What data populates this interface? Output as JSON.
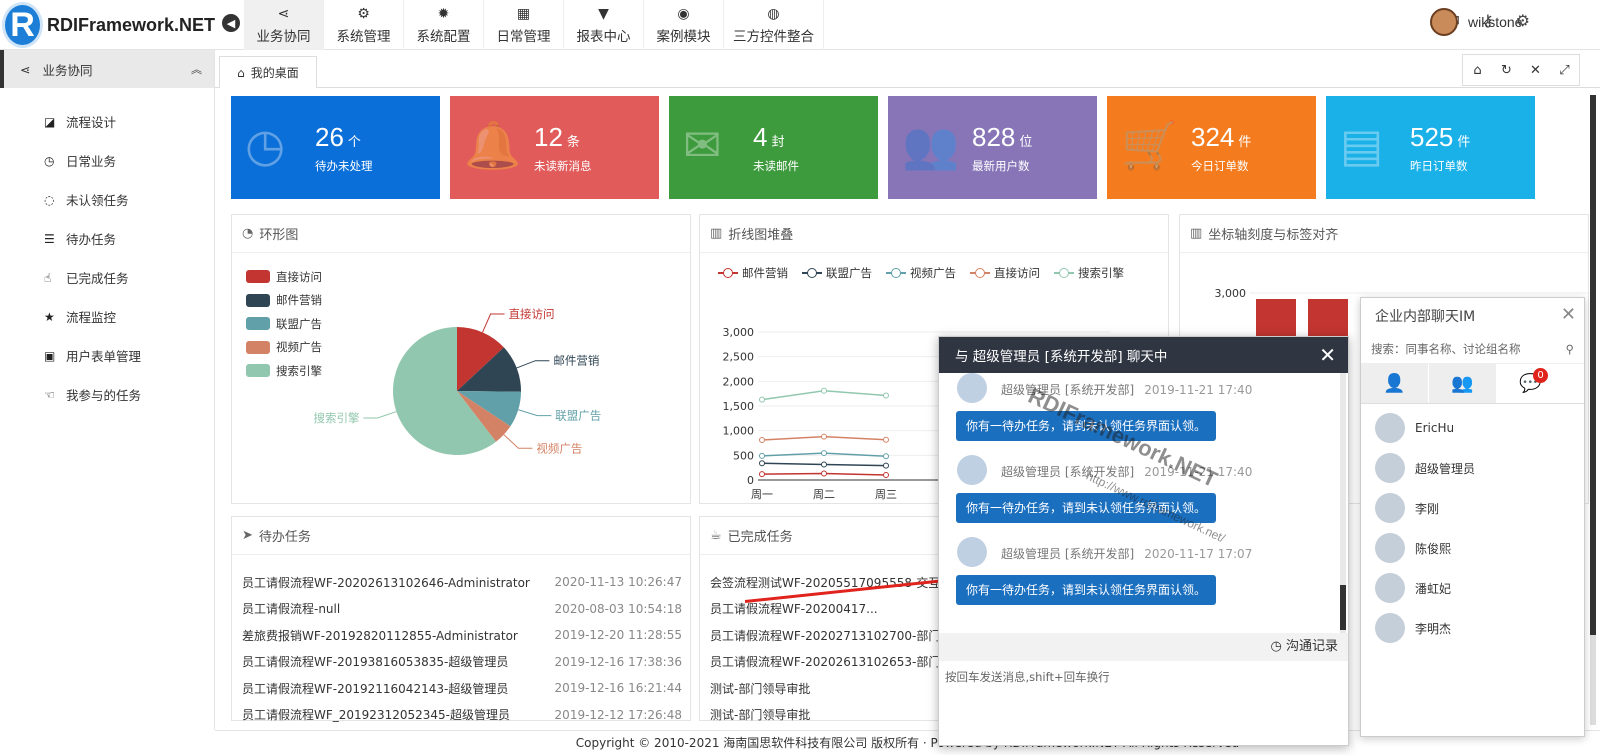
{
  "brand": {
    "logo_letter": "R",
    "name": "RDIFramework.NET"
  },
  "topnav": [
    {
      "label": "业务协同",
      "icon": "share-icon",
      "active": true
    },
    {
      "label": "系统管理",
      "icon": "gears-icon"
    },
    {
      "label": "系统配置",
      "icon": "gear-icon"
    },
    {
      "label": "日常管理",
      "icon": "calendar-icon"
    },
    {
      "label": "报表中心",
      "icon": "filter-icon"
    },
    {
      "label": "案例模块",
      "icon": "eye-icon"
    },
    {
      "label": "三方控件整合",
      "icon": "globe-icon"
    }
  ],
  "user": {
    "name": "wikstone"
  },
  "sidebar": {
    "title": "业务协同",
    "items": [
      {
        "label": "流程设计",
        "icon": "edit-icon"
      },
      {
        "label": "日常业务",
        "icon": "clock-icon"
      },
      {
        "label": "未认领任务",
        "icon": "circle-icon"
      },
      {
        "label": "待办任务",
        "icon": "list-icon"
      },
      {
        "label": "已完成任务",
        "icon": "hand-icon"
      },
      {
        "label": "流程监控",
        "icon": "star-icon"
      },
      {
        "label": "用户表单管理",
        "icon": "form-icon"
      },
      {
        "label": "我参与的任务",
        "icon": "hand-left-icon"
      }
    ]
  },
  "tab": {
    "label": "我的桌面"
  },
  "stats": [
    {
      "num": "26",
      "unit": "个",
      "label": "待办未处理",
      "color": "#0a6fd8",
      "icon": "clock-icon"
    },
    {
      "num": "12",
      "unit": "条",
      "label": "未读新消息",
      "color": "#e25b5b",
      "icon": "bell-icon"
    },
    {
      "num": "4",
      "unit": "封",
      "label": "未读邮件",
      "color": "#3d9a3d",
      "icon": "envelope-icon"
    },
    {
      "num": "828",
      "unit": "位",
      "label": "最新用户数",
      "color": "#8775b8",
      "icon": "users-icon"
    },
    {
      "num": "324",
      "unit": "件",
      "label": "今日订单数",
      "color": "#f47c1f",
      "icon": "cart-icon"
    },
    {
      "num": "525",
      "unit": "件",
      "label": "昨日订单数",
      "color": "#1ab0e8",
      "icon": "doc-icon"
    }
  ],
  "panels": {
    "pie": {
      "title": "环形图"
    },
    "line": {
      "title": "折线图堆叠"
    },
    "bar": {
      "title": "坐标轴刻度与标签对齐"
    },
    "todo": {
      "title": "待办任务"
    },
    "done": {
      "title": "已完成任务"
    }
  },
  "chart_data": [
    {
      "type": "pie",
      "title": "环形图",
      "legend_placement": "top-left",
      "series": [
        {
          "name": "直接访问",
          "value": 335,
          "color": "#c23531"
        },
        {
          "name": "邮件营销",
          "value": 310,
          "color": "#2f4554"
        },
        {
          "name": "联盟广告",
          "value": 234,
          "color": "#61a0a8"
        },
        {
          "name": "视频广告",
          "value": 135,
          "color": "#d48265"
        },
        {
          "name": "搜索引擎",
          "value": 1548,
          "color": "#91c7ae"
        }
      ]
    },
    {
      "type": "line",
      "title": "折线图堆叠",
      "categories": [
        "周一",
        "周二",
        "周三"
      ],
      "ylim": [
        0,
        3000
      ],
      "yticks": [
        "0",
        "500",
        "1,000",
        "1,500",
        "2,000",
        "2,500",
        "3,000"
      ],
      "series": [
        {
          "name": "邮件营销",
          "color": "#c23531",
          "values": [
            120,
            132,
            101
          ]
        },
        {
          "name": "联盟广告",
          "color": "#2f4554",
          "values": [
            340,
            314,
            292
          ]
        },
        {
          "name": "视频广告",
          "color": "#61a0a8",
          "values": [
            490,
            546,
            482
          ]
        },
        {
          "name": "直接访问",
          "color": "#d48265",
          "values": [
            810,
            878,
            816
          ]
        },
        {
          "name": "搜索引擎",
          "color": "#91c7ae",
          "values": [
            1630,
            1810,
            1712
          ]
        }
      ]
    },
    {
      "type": "bar",
      "title": "坐标轴刻度与标签对齐",
      "ylim": [
        0,
        3000
      ],
      "yticks": [
        "3,000"
      ],
      "values": [
        3000,
        3000
      ],
      "color": "#c23531"
    }
  ],
  "todo": [
    {
      "title": "员工请假流程WF-20202613102646-Administrator",
      "date": "2020-11-13 10:26:47"
    },
    {
      "title": "员工请假流程-null",
      "date": "2020-08-03 10:54:18"
    },
    {
      "title": "差旅费报销WF-20192820112855-Administrator",
      "date": "2019-12-20 11:28:55"
    },
    {
      "title": "员工请假流程WF-20193816053835-超级管理员",
      "date": "2019-12-16 17:38:36"
    },
    {
      "title": "员工请假流程WF-20192116042143-超级管理员",
      "date": "2019-12-16 16:21:44"
    },
    {
      "title": "员工请假流程WF_20192312052345-超级管理员",
      "date": "2019-12-12 17:26:48"
    }
  ],
  "done": [
    {
      "title": "会签流程测试WF-20205517095558-交互"
    },
    {
      "title": "员工请假流程WF-20200417..."
    },
    {
      "title": "员工请假流程WF-20202713102700-部门"
    },
    {
      "title": "员工请假流程WF-20202613102653-部门"
    },
    {
      "title": "测试-部门领导审批"
    },
    {
      "title": "测试-部门领导审批"
    }
  ],
  "chat": {
    "title": "与 超级管理员 [系统开发部] 聊天中",
    "messages": [
      {
        "who": "超级管理员 [系统开发部]",
        "time": "2019-11-21 17:40",
        "text": "你有一待办任务，请到未认领任务界面认领。"
      },
      {
        "who": "超级管理员 [系统开发部]",
        "time": "2019-11-21 17:40",
        "text": "你有一待办任务，请到未认领任务界面认领。"
      },
      {
        "who": "超级管理员 [系统开发部]",
        "time": "2020-11-17 17:07",
        "text": "你有一待办任务，请到未认领任务界面认领。"
      }
    ],
    "history": "沟通记录",
    "input_hint": "按回车发送消息,shift+回车换行",
    "watermark": "RDIFramework.NET",
    "watermark_url": "http://www.rdiframework.net/"
  },
  "im": {
    "title": "企业内部聊天IM",
    "search_placeholder": "搜索：同事名称、讨论组名称",
    "badge": "0",
    "contacts": [
      "EricHu",
      "超级管理员",
      "李刚",
      "陈俊熙",
      "潘虹妃",
      "李明杰"
    ]
  },
  "footer": "Copyright © 2010-2021 海南国思软件科技有限公司 版权所有 · Powered by RDIFramework.NET All Rights Reserved"
}
